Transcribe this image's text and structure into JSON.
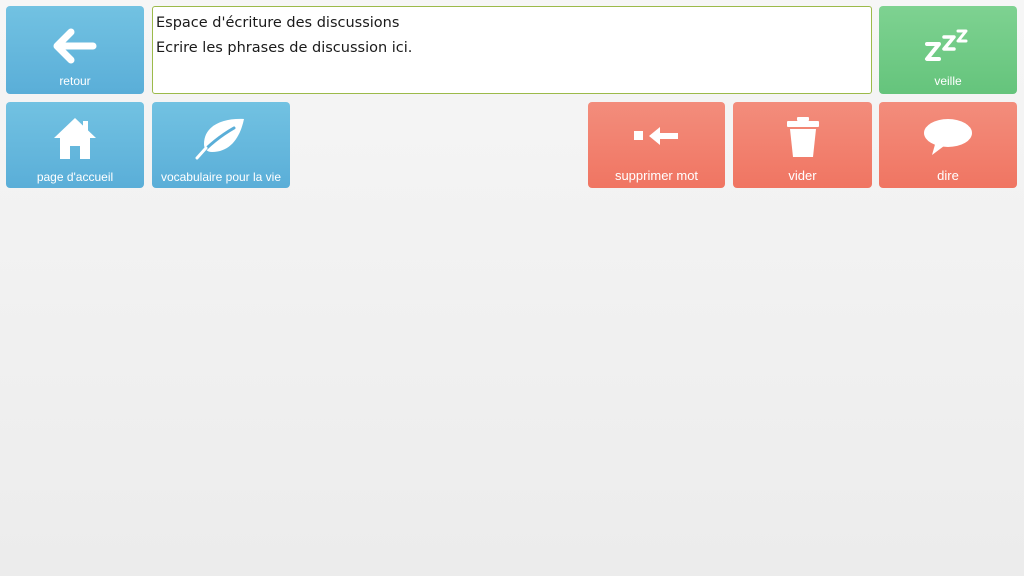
{
  "toolbar": {
    "back": {
      "label": "retour",
      "icon": "arrow-left-icon"
    },
    "sleep": {
      "label": "veille",
      "icon": "zzz-icon"
    },
    "home": {
      "label": "page d'accueil",
      "icon": "house-icon"
    },
    "vocabulary": {
      "label": "vocabulaire pour la vie",
      "icon": "leaf-icon"
    },
    "delete_word": {
      "label": "supprimer mot",
      "icon": "backspace-icon"
    },
    "clear": {
      "label": "vider",
      "icon": "trash-icon"
    },
    "say": {
      "label": "dire",
      "icon": "speech-bubble-icon"
    }
  },
  "message_area": {
    "lines": [
      "Espace d'écriture des discussions",
      "Ecrire les phrases de discussion ici."
    ]
  },
  "colors": {
    "nav_blue": "#5aaed8",
    "sleep_green": "#65c47c",
    "action_red": "#f07562",
    "text_area_border": "#9cba4a"
  }
}
